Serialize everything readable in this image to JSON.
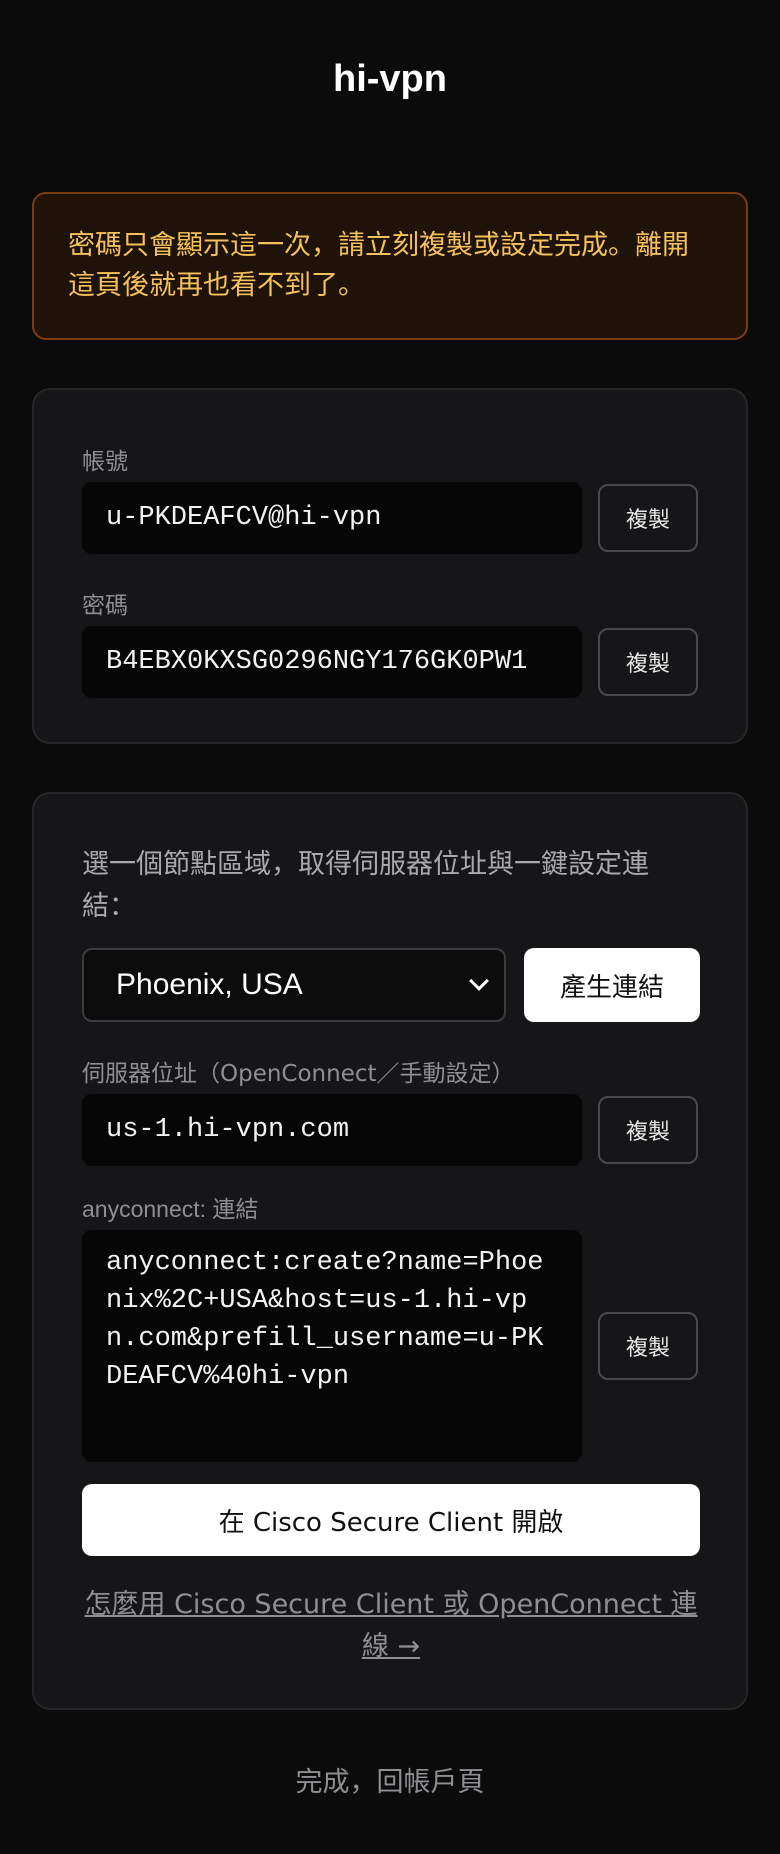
{
  "app": {
    "title": "hi-vpn"
  },
  "warning": {
    "text": "密碼只會顯示這一次，請立刻複製或設定完成。離開這頁後就再也看不到了。",
    "color": "#f4c15a"
  },
  "credentials": {
    "account_label": "帳號",
    "account_value": "u-PKDEAFCV@hi-vpn",
    "password_label": "密碼",
    "password_value": "B4EBX0KXSG0296NGY176GK0PW1",
    "copy_label": "複製"
  },
  "region": {
    "prompt": "選一個節點區域，取得伺服器位址與一鍵設定連結：",
    "selected": "Phoenix, USA",
    "generate_label": "產生連結",
    "server_label": "伺服器位址（OpenConnect／手動設定）",
    "server_value": "us-1.hi-vpn.com",
    "link_label": "anyconnect: 連結",
    "link_value": "anyconnect:create?name=Phoenix%2C+USA&host=us-1.hi-vpn.com&prefill_username=u-PKDEAFCV%40hi-vpn",
    "copy_label": "複製",
    "open_label": "在 Cisco Secure Client 開啟",
    "howto_label": "怎麼用 Cisco Secure Client 或 OpenConnect 連線 →"
  },
  "footer": {
    "done_label": "完成，回帳戶頁"
  },
  "icons": {
    "select_arrow": "chevron-down-icon"
  }
}
